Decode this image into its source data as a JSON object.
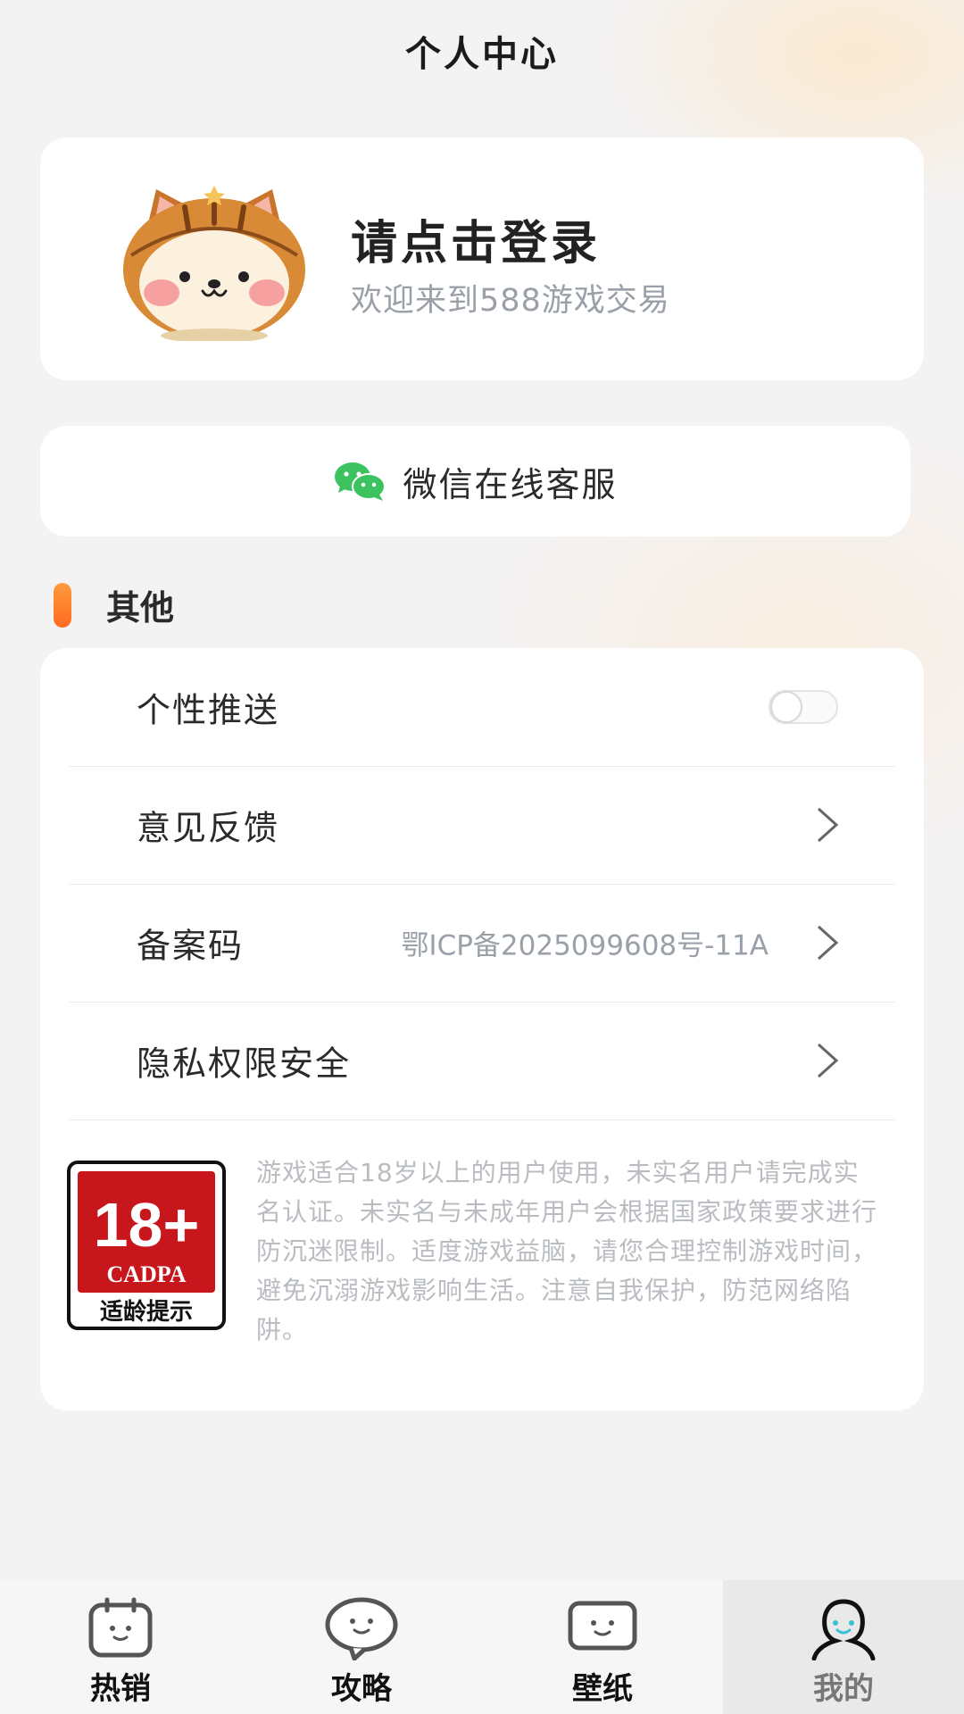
{
  "header": {
    "title": "个人中心"
  },
  "profile": {
    "login_prompt": "请点击登录",
    "welcome_text": "欢迎来到588游戏交易"
  },
  "service": {
    "label": "微信在线客服",
    "icon": "wechat-icon"
  },
  "section": {
    "title": "其他"
  },
  "settings": {
    "push": {
      "label": "个性推送",
      "enabled": false
    },
    "feedback": {
      "label": "意见反馈"
    },
    "icp": {
      "label": "备案码",
      "value": "鄂ICP备2025099608号-11A"
    },
    "privacy": {
      "label": "隐私权限安全"
    }
  },
  "age_rating": {
    "rating": "18+",
    "org": "CADPA",
    "caption": "适龄提示",
    "notice": "游戏适合18岁以上的用户使用，未实名用户请完成实名认证。未实名与未成年用户会根据国家政策要求进行防沉迷限制。适度游戏益脑，请您合理控制游戏时间，避免沉溺游戏影响生活。注意自我保护，防范网络陷阱。"
  },
  "tabbar": {
    "items": [
      {
        "label": "热销",
        "icon": "calendar-face-icon",
        "active": false
      },
      {
        "label": "攻略",
        "icon": "chat-bubble-face-icon",
        "active": false
      },
      {
        "label": "壁纸",
        "icon": "screen-face-icon",
        "active": false
      },
      {
        "label": "我的",
        "icon": "person-icon",
        "active": true
      }
    ]
  },
  "colors": {
    "accent": "#ff7a2a",
    "wechat": "#3cc35f",
    "badge_red": "#c8161d",
    "muted_text": "#9aa0a8"
  }
}
